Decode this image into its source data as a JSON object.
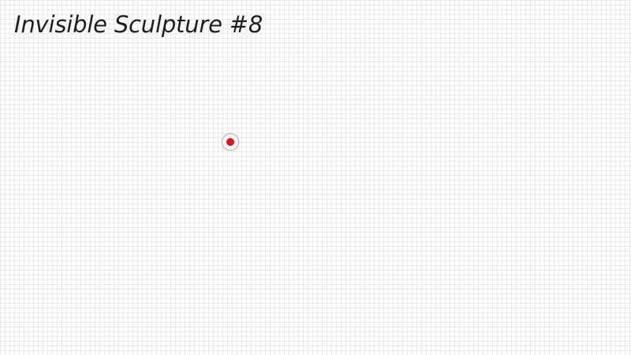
{
  "title": "Invisible Sculpture #8",
  "marker": {
    "icon": "target-marker-icon",
    "color": "#e3121b",
    "ring_color": "#f08a8a"
  },
  "canvas": {
    "background": "#ffffff",
    "grid_color": "#e9e9e9"
  }
}
